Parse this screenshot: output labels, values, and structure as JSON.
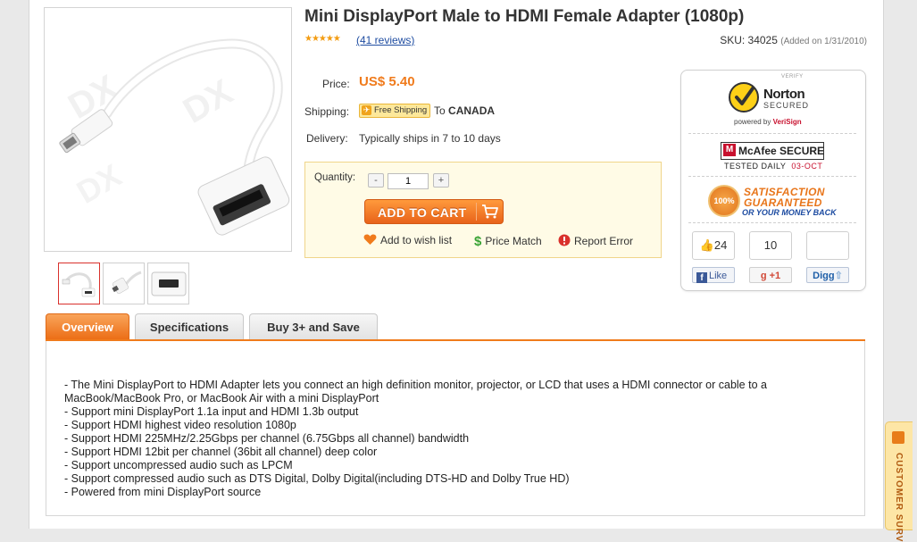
{
  "product": {
    "title": "Mini DisplayPort Male to HDMI Female Adapter (1080p)",
    "rating_stars": "★★★★★",
    "reviews_link": "(41 reviews)",
    "sku": "SKU: 34025",
    "added": "(Added on 1/31/2010)"
  },
  "pricing": {
    "price_label": "Price:",
    "price_value": "US$ 5.40",
    "shipping_label": "Shipping:",
    "free_shipping": "Free Shipping",
    "ship_to": "To",
    "country": "CANADA",
    "delivery_label": "Delivery:",
    "delivery_value": "Typically ships in 7 to 10 days"
  },
  "purchase": {
    "quantity_label": "Quantity:",
    "minus": "-",
    "plus": "+",
    "quantity_value": "1",
    "add_to_cart": "ADD TO CART",
    "wish_list": "Add to wish list",
    "price_match": "Price Match",
    "report_error": "Report Error"
  },
  "trust": {
    "verify": "VERIFY",
    "norton": "Norton",
    "secured": "SECURED",
    "powered_by": "powered by",
    "verisign": "VeriSign",
    "mcafee": "McAfee SECURE",
    "tested_daily": "TESTED DAILY",
    "tested_date": "03-OCT",
    "seal": "100%",
    "satisfaction": "SATISFACTION",
    "guaranteed": "GUARANTEED",
    "money_back": "OR YOUR MONEY BACK",
    "like_count": "24",
    "plus_count": "10",
    "like": "Like",
    "plus_one": "+1",
    "digg": "Digg"
  },
  "tabs": [
    {
      "label": "Overview"
    },
    {
      "label": "Specifications"
    },
    {
      "label": "Buy 3+ and Save"
    }
  ],
  "description": [
    "- The Mini DisplayPort to HDMI Adapter lets you connect an high definition monitor, projector, or LCD that uses a HDMI connector or cable to a MacBook/MacBook Pro, or MacBook Air with a mini DisplayPort",
    "- Support mini DisplayPort 1.1a input and HDMI 1.3b output",
    "- Support HDMI highest video resolution 1080p",
    "- Support HDMI 225MHz/2.25Gbps per channel (6.75Gbps all channel) bandwidth",
    "- Support HDMI 12bit per channel (36bit all channel) deep color",
    "- Support uncompressed audio such as LPCM",
    "- Support compressed audio such as DTS Digital, Dolby Digital(including DTS-HD and Dolby True HD)",
    "- Powered from mini DisplayPort source"
  ],
  "survey": {
    "label": "CUSTOMER SURV"
  },
  "colors": {
    "accent": "#f07b1c",
    "link": "#1f4da1"
  }
}
